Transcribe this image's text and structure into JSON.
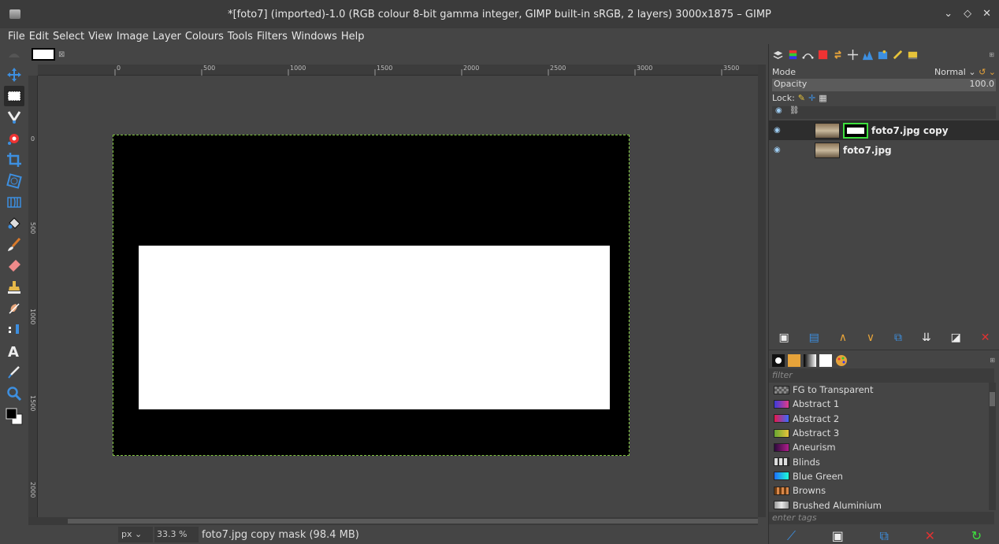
{
  "window": {
    "title": "*[foto7] (imported)-1.0 (RGB colour 8-bit gamma integer, GIMP built-in sRGB, 2 layers) 3000x1875 – GIMP",
    "controls": [
      "⌄",
      "◇",
      "✕"
    ]
  },
  "menu": [
    "File",
    "Edit",
    "Select",
    "View",
    "Image",
    "Layer",
    "Colours",
    "Tools",
    "Filters",
    "Windows",
    "Help"
  ],
  "tools": [
    "move-tool",
    "rect-select-tool",
    "fuzzy-select-tool",
    "foreground-select-tool",
    "crop-tool",
    "unified-transform-tool",
    "warp-transform-tool",
    "bucket-fill-tool",
    "paintbrush-tool",
    "eraser-tool",
    "clone-tool",
    "smudge-tool",
    "dodge-tool",
    "text-tool",
    "color-picker-tool",
    "zoom-tool"
  ],
  "rulers": {
    "h_labels": [
      "0",
      "500",
      "1000",
      "1500",
      "2000",
      "2500",
      "3000",
      "3500"
    ],
    "v_labels": [
      "0",
      "500",
      "1000",
      "1500",
      "2000"
    ]
  },
  "status": {
    "unit": "px ⌄",
    "zoom": "33.3 % ⌄",
    "message": "foto7.jpg copy mask (98.4  MB)"
  },
  "layers_panel": {
    "mode_label": "Mode",
    "mode_value": "Normal ⌄",
    "opacity_label": "Opacity",
    "opacity_value": "100.0",
    "lock_label": "Lock:",
    "layers": [
      {
        "name": "foto7.jpg copy",
        "has_mask": true,
        "selected": true
      },
      {
        "name": "foto7.jpg",
        "has_mask": false,
        "selected": false
      }
    ]
  },
  "gradients_panel": {
    "filter_placeholder": "filter",
    "tags_placeholder": "enter tags",
    "items": [
      {
        "name": "FG to Transparent",
        "colors": [
          "#111111",
          "#888888"
        ]
      },
      {
        "name": "Abstract 1",
        "colors": [
          "#3b3bd9",
          "#e23b8a"
        ]
      },
      {
        "name": "Abstract 2",
        "colors": [
          "#e6194b",
          "#3a6bff"
        ]
      },
      {
        "name": "Abstract 3",
        "colors": [
          "#67a832",
          "#e7c33a"
        ]
      },
      {
        "name": "Aneurism",
        "colors": [
          "#2a0a3a",
          "#b01e8c"
        ]
      },
      {
        "name": "Blinds",
        "colors": [
          "#dddddd",
          "#333333"
        ]
      },
      {
        "name": "Blue Green",
        "colors": [
          "#1e6eff",
          "#1effd6"
        ]
      },
      {
        "name": "Browns",
        "colors": [
          "#6b3b12",
          "#d9884a"
        ]
      },
      {
        "name": "Brushed Aluminium",
        "colors": [
          "#9a9a9a",
          "#e8e8e8"
        ]
      }
    ]
  },
  "colors": {
    "selection_border": "#7fc440",
    "mask_border": "#3ee03e",
    "delete": "#e03232",
    "refresh": "#3ee03e"
  }
}
